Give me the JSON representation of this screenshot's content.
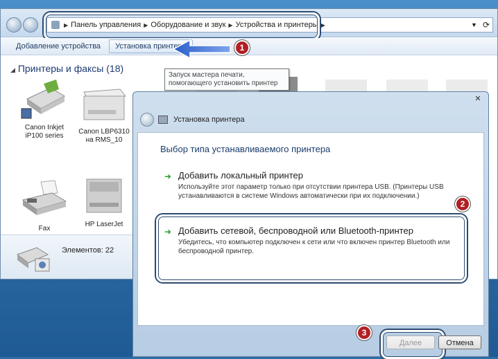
{
  "address": {
    "crumbs": [
      "Панель управления",
      "Оборудование и звук",
      "Устройства и принтеры"
    ]
  },
  "toolbar": {
    "add_device": "Добавление устройства",
    "add_printer": "Установка принтера"
  },
  "tooltip": "Запуск мастера печати, помогающего установить принтер",
  "group": {
    "title": "Принтеры и факсы (18)"
  },
  "devices": [
    {
      "line1": "Canon Inkjet",
      "line2": "iP100 series"
    },
    {
      "line1": "Canon LBP6310",
      "line2": "на RMS_10"
    },
    {
      "line1": "Fax",
      "line2": ""
    },
    {
      "line1": "HP LaserJet",
      "line2": ""
    }
  ],
  "status": {
    "count": "Элементов: 22"
  },
  "dialog": {
    "title": "Установка принтера",
    "heading": "Выбор типа устанавливаемого принтера",
    "option1": {
      "title": "Добавить локальный принтер",
      "desc": "Используйте этот параметр только при отсутствии принтера USB. (Принтеры USB устанавливаются в системе Windows автоматически при их подключении.)"
    },
    "option2": {
      "title": "Добавить сетевой, беспроводной или Bluetooth-принтер",
      "desc": "Убедитесь, что компьютер подключен к сети или что включен принтер Bluetooth или беспроводной принтер."
    },
    "next_label": "Далее",
    "cancel_label": "Отмена"
  },
  "badges": [
    "1",
    "2",
    "3"
  ],
  "colors": {
    "badge": "#b21f24",
    "highlight_border": "#2b4a6f",
    "arrow": "#3b6fd6",
    "heading": "#1a3c6e"
  }
}
